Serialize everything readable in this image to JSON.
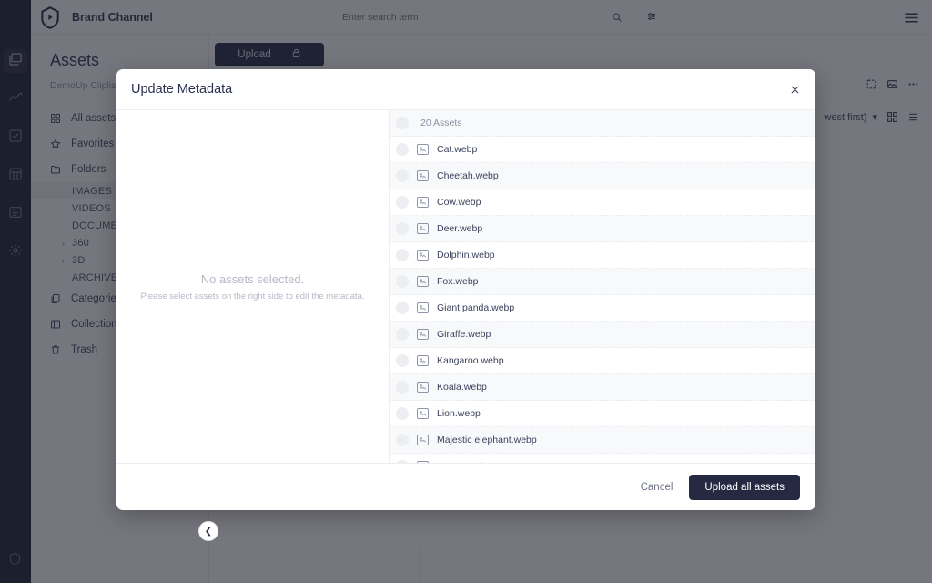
{
  "app": {
    "brand_name": "Brand Channel",
    "search": {
      "placeholder": "Enter search term",
      "value": ""
    },
    "page_title": "Assets",
    "breadcrumb": "DemoUp Cliplis",
    "upload_label": "Upload",
    "sort_label": "west first)",
    "nav": [
      {
        "label": "All assets",
        "icon": "grid-icon"
      },
      {
        "label": "Favorites",
        "icon": "star-icon"
      },
      {
        "label": "Folders",
        "icon": "folder-icon"
      }
    ],
    "folders": [
      {
        "label": "IMAGES",
        "selected": true,
        "caret": false
      },
      {
        "label": "VIDEOS",
        "selected": false,
        "caret": false
      },
      {
        "label": "DOCUMEN",
        "selected": false,
        "caret": false
      },
      {
        "label": "360",
        "selected": false,
        "caret": true
      },
      {
        "label": "3D",
        "selected": false,
        "caret": true
      },
      {
        "label": "ARCHIVE",
        "selected": false,
        "caret": false
      }
    ],
    "nav_bottom": [
      {
        "label": "Categories",
        "icon": "categories-icon"
      },
      {
        "label": "Collections",
        "icon": "collections-icon"
      },
      {
        "label": "Trash",
        "icon": "trash-icon"
      }
    ],
    "rail_icons": [
      "assets-icon",
      "analytics-icon",
      "tasks-icon",
      "table-icon",
      "document-icon",
      "settings-icon"
    ]
  },
  "modal": {
    "title": "Update Metadata",
    "empty_state": {
      "title": "No assets selected.",
      "subtitle": "Please select assets on the right side to edit the metadata."
    },
    "list_header": "20 Assets",
    "assets": [
      {
        "name": "Cat.webp"
      },
      {
        "name": "Cheetah.webp"
      },
      {
        "name": "Cow.webp"
      },
      {
        "name": "Deer.webp"
      },
      {
        "name": "Dolphin.webp"
      },
      {
        "name": "Fox.webp"
      },
      {
        "name": "Giant panda.webp"
      },
      {
        "name": "Giraffe.webp"
      },
      {
        "name": "Kangaroo.webp"
      },
      {
        "name": "Koala.webp"
      },
      {
        "name": "Lion.webp"
      },
      {
        "name": "Majestic elephant.webp"
      },
      {
        "name": "Mouse.webp"
      }
    ],
    "footer": {
      "cancel_label": "Cancel",
      "primary_label": "Upload all assets"
    }
  },
  "colors": {
    "primary_dark": "#252a42",
    "rail_bg": "#14182e",
    "overlay": "rgba(34,36,46,0.62)"
  }
}
